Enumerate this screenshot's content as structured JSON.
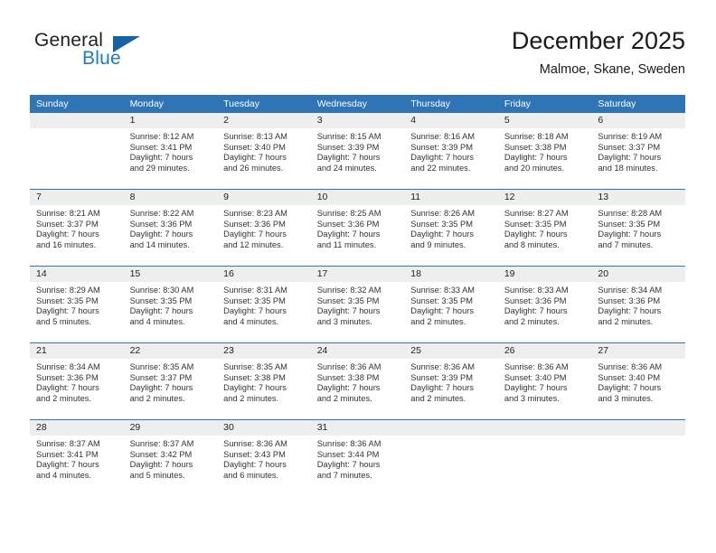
{
  "logo": {
    "word_top": "General",
    "word_bottom": "Blue",
    "triangle_color": "#1464a5",
    "blue_color": "#1e7bc4"
  },
  "header": {
    "title": "December 2025",
    "subtitle": "Malmoe, Skane, Sweden"
  },
  "theme": {
    "header_blue": "#2f75b5",
    "daynum_band": "#eeeeee",
    "text": "#222222"
  },
  "weekday_headers": [
    "Sunday",
    "Monday",
    "Tuesday",
    "Wednesday",
    "Thursday",
    "Friday",
    "Saturday"
  ],
  "weeks": [
    [
      {
        "day": "",
        "sunrise": "",
        "sunset": "",
        "daylight_line1": "",
        "daylight_line2": ""
      },
      {
        "day": "1",
        "sunrise": "Sunrise: 8:12 AM",
        "sunset": "Sunset: 3:41 PM",
        "daylight_line1": "Daylight: 7 hours",
        "daylight_line2": "and 29 minutes."
      },
      {
        "day": "2",
        "sunrise": "Sunrise: 8:13 AM",
        "sunset": "Sunset: 3:40 PM",
        "daylight_line1": "Daylight: 7 hours",
        "daylight_line2": "and 26 minutes."
      },
      {
        "day": "3",
        "sunrise": "Sunrise: 8:15 AM",
        "sunset": "Sunset: 3:39 PM",
        "daylight_line1": "Daylight: 7 hours",
        "daylight_line2": "and 24 minutes."
      },
      {
        "day": "4",
        "sunrise": "Sunrise: 8:16 AM",
        "sunset": "Sunset: 3:39 PM",
        "daylight_line1": "Daylight: 7 hours",
        "daylight_line2": "and 22 minutes."
      },
      {
        "day": "5",
        "sunrise": "Sunrise: 8:18 AM",
        "sunset": "Sunset: 3:38 PM",
        "daylight_line1": "Daylight: 7 hours",
        "daylight_line2": "and 20 minutes."
      },
      {
        "day": "6",
        "sunrise": "Sunrise: 8:19 AM",
        "sunset": "Sunset: 3:37 PM",
        "daylight_line1": "Daylight: 7 hours",
        "daylight_line2": "and 18 minutes."
      }
    ],
    [
      {
        "day": "7",
        "sunrise": "Sunrise: 8:21 AM",
        "sunset": "Sunset: 3:37 PM",
        "daylight_line1": "Daylight: 7 hours",
        "daylight_line2": "and 16 minutes."
      },
      {
        "day": "8",
        "sunrise": "Sunrise: 8:22 AM",
        "sunset": "Sunset: 3:36 PM",
        "daylight_line1": "Daylight: 7 hours",
        "daylight_line2": "and 14 minutes."
      },
      {
        "day": "9",
        "sunrise": "Sunrise: 8:23 AM",
        "sunset": "Sunset: 3:36 PM",
        "daylight_line1": "Daylight: 7 hours",
        "daylight_line2": "and 12 minutes."
      },
      {
        "day": "10",
        "sunrise": "Sunrise: 8:25 AM",
        "sunset": "Sunset: 3:36 PM",
        "daylight_line1": "Daylight: 7 hours",
        "daylight_line2": "and 11 minutes."
      },
      {
        "day": "11",
        "sunrise": "Sunrise: 8:26 AM",
        "sunset": "Sunset: 3:35 PM",
        "daylight_line1": "Daylight: 7 hours",
        "daylight_line2": "and 9 minutes."
      },
      {
        "day": "12",
        "sunrise": "Sunrise: 8:27 AM",
        "sunset": "Sunset: 3:35 PM",
        "daylight_line1": "Daylight: 7 hours",
        "daylight_line2": "and 8 minutes."
      },
      {
        "day": "13",
        "sunrise": "Sunrise: 8:28 AM",
        "sunset": "Sunset: 3:35 PM",
        "daylight_line1": "Daylight: 7 hours",
        "daylight_line2": "and 7 minutes."
      }
    ],
    [
      {
        "day": "14",
        "sunrise": "Sunrise: 8:29 AM",
        "sunset": "Sunset: 3:35 PM",
        "daylight_line1": "Daylight: 7 hours",
        "daylight_line2": "and 5 minutes."
      },
      {
        "day": "15",
        "sunrise": "Sunrise: 8:30 AM",
        "sunset": "Sunset: 3:35 PM",
        "daylight_line1": "Daylight: 7 hours",
        "daylight_line2": "and 4 minutes."
      },
      {
        "day": "16",
        "sunrise": "Sunrise: 8:31 AM",
        "sunset": "Sunset: 3:35 PM",
        "daylight_line1": "Daylight: 7 hours",
        "daylight_line2": "and 4 minutes."
      },
      {
        "day": "17",
        "sunrise": "Sunrise: 8:32 AM",
        "sunset": "Sunset: 3:35 PM",
        "daylight_line1": "Daylight: 7 hours",
        "daylight_line2": "and 3 minutes."
      },
      {
        "day": "18",
        "sunrise": "Sunrise: 8:33 AM",
        "sunset": "Sunset: 3:35 PM",
        "daylight_line1": "Daylight: 7 hours",
        "daylight_line2": "and 2 minutes."
      },
      {
        "day": "19",
        "sunrise": "Sunrise: 8:33 AM",
        "sunset": "Sunset: 3:36 PM",
        "daylight_line1": "Daylight: 7 hours",
        "daylight_line2": "and 2 minutes."
      },
      {
        "day": "20",
        "sunrise": "Sunrise: 8:34 AM",
        "sunset": "Sunset: 3:36 PM",
        "daylight_line1": "Daylight: 7 hours",
        "daylight_line2": "and 2 minutes."
      }
    ],
    [
      {
        "day": "21",
        "sunrise": "Sunrise: 8:34 AM",
        "sunset": "Sunset: 3:36 PM",
        "daylight_line1": "Daylight: 7 hours",
        "daylight_line2": "and 2 minutes."
      },
      {
        "day": "22",
        "sunrise": "Sunrise: 8:35 AM",
        "sunset": "Sunset: 3:37 PM",
        "daylight_line1": "Daylight: 7 hours",
        "daylight_line2": "and 2 minutes."
      },
      {
        "day": "23",
        "sunrise": "Sunrise: 8:35 AM",
        "sunset": "Sunset: 3:38 PM",
        "daylight_line1": "Daylight: 7 hours",
        "daylight_line2": "and 2 minutes."
      },
      {
        "day": "24",
        "sunrise": "Sunrise: 8:36 AM",
        "sunset": "Sunset: 3:38 PM",
        "daylight_line1": "Daylight: 7 hours",
        "daylight_line2": "and 2 minutes."
      },
      {
        "day": "25",
        "sunrise": "Sunrise: 8:36 AM",
        "sunset": "Sunset: 3:39 PM",
        "daylight_line1": "Daylight: 7 hours",
        "daylight_line2": "and 2 minutes."
      },
      {
        "day": "26",
        "sunrise": "Sunrise: 8:36 AM",
        "sunset": "Sunset: 3:40 PM",
        "daylight_line1": "Daylight: 7 hours",
        "daylight_line2": "and 3 minutes."
      },
      {
        "day": "27",
        "sunrise": "Sunrise: 8:36 AM",
        "sunset": "Sunset: 3:40 PM",
        "daylight_line1": "Daylight: 7 hours",
        "daylight_line2": "and 3 minutes."
      }
    ],
    [
      {
        "day": "28",
        "sunrise": "Sunrise: 8:37 AM",
        "sunset": "Sunset: 3:41 PM",
        "daylight_line1": "Daylight: 7 hours",
        "daylight_line2": "and 4 minutes."
      },
      {
        "day": "29",
        "sunrise": "Sunrise: 8:37 AM",
        "sunset": "Sunset: 3:42 PM",
        "daylight_line1": "Daylight: 7 hours",
        "daylight_line2": "and 5 minutes."
      },
      {
        "day": "30",
        "sunrise": "Sunrise: 8:36 AM",
        "sunset": "Sunset: 3:43 PM",
        "daylight_line1": "Daylight: 7 hours",
        "daylight_line2": "and 6 minutes."
      },
      {
        "day": "31",
        "sunrise": "Sunrise: 8:36 AM",
        "sunset": "Sunset: 3:44 PM",
        "daylight_line1": "Daylight: 7 hours",
        "daylight_line2": "and 7 minutes."
      },
      {
        "day": "",
        "sunrise": "",
        "sunset": "",
        "daylight_line1": "",
        "daylight_line2": ""
      },
      {
        "day": "",
        "sunrise": "",
        "sunset": "",
        "daylight_line1": "",
        "daylight_line2": ""
      },
      {
        "day": "",
        "sunrise": "",
        "sunset": "",
        "daylight_line1": "",
        "daylight_line2": ""
      }
    ]
  ]
}
